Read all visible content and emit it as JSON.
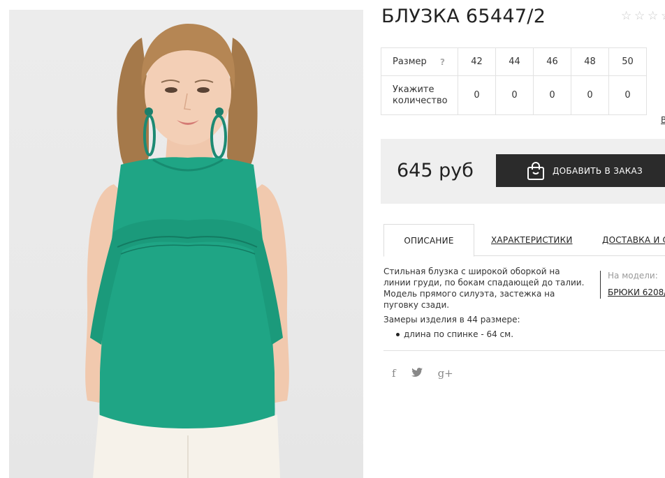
{
  "product": {
    "title": "БЛУЗКА 65447/2",
    "rating_icons": [
      "star-empty",
      "star-empty",
      "star-empty",
      "star-empty"
    ]
  },
  "size_table": {
    "size_label": "Размер",
    "help_mark": "?",
    "sizes": [
      "42",
      "44",
      "46",
      "48",
      "50"
    ],
    "qty_label": "Укажите количество",
    "quantities": [
      "0",
      "0",
      "0",
      "0",
      "0"
    ]
  },
  "edge_link": "В",
  "order": {
    "price": "645 руб",
    "add_button": "ДОБАВИТЬ В ЗАКАЗ",
    "bag_icon": "shopping-bag-icon"
  },
  "tabs": {
    "description": "ОПИСАНИЕ",
    "characteristics": "ХАРАКТЕРИСТИКИ",
    "delivery": "ДОСТАВКА И ОП"
  },
  "description": {
    "text": "Стильная блузка с широкой оборкой на линии груди, по бокам спадающей до талии. Модель прямого силуэта, застежка на пуговку сзади.",
    "measure_title": "Замеры изделия в 44 размере:",
    "measures": [
      "длина по спинке - 64 см."
    ]
  },
  "model": {
    "label": "На модели:",
    "link": "БРЮКИ 6208/"
  },
  "social": {
    "facebook": "f",
    "twitter": "🐦",
    "gplus": "g+"
  },
  "colors": {
    "blouse": "#1fa585",
    "dark_button": "#2b2b2b",
    "panel_bg": "#efefef"
  }
}
